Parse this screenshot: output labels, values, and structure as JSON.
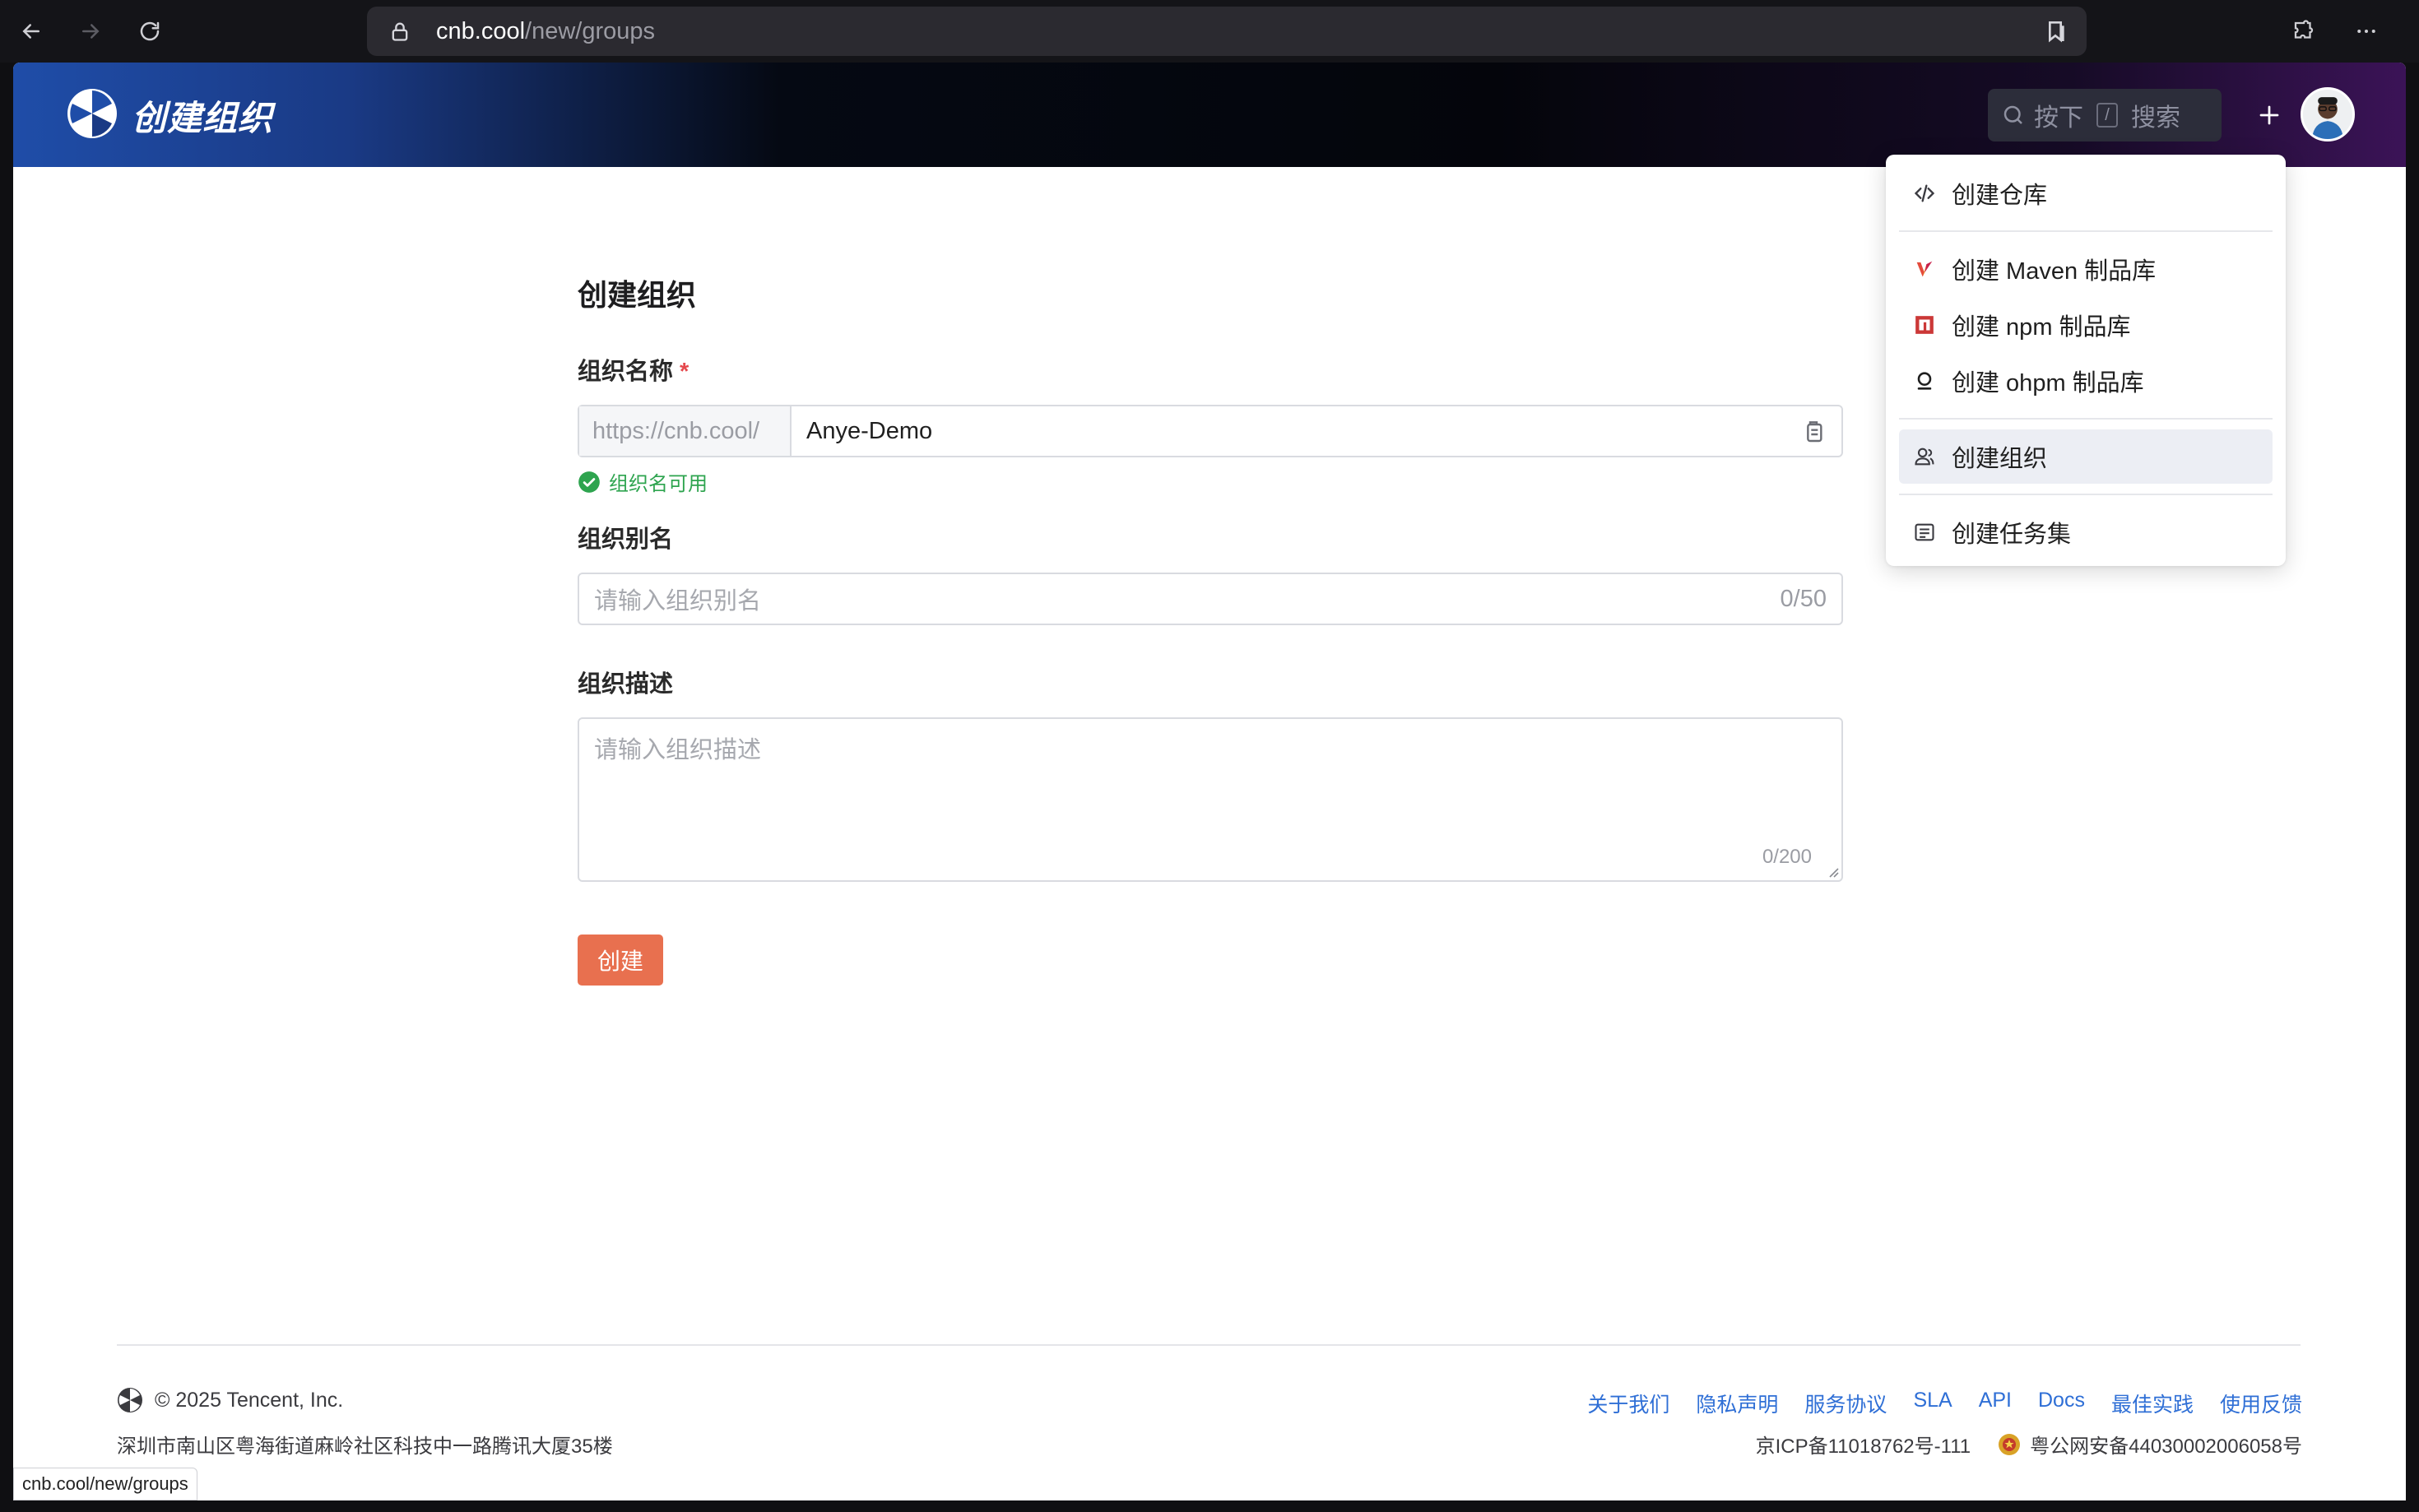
{
  "browser": {
    "url_host": "cnb.cool",
    "url_path": "/new/groups",
    "status_url": "cnb.cool/new/groups"
  },
  "header": {
    "title": "创建组织",
    "search_prefix": "按下",
    "search_key": "/",
    "search_suffix": "搜索"
  },
  "form": {
    "title": "创建组织",
    "name_label": "组织名称",
    "required_mark": "*",
    "name_prefix": "https://cnb.cool/",
    "name_value": "Anye-Demo",
    "name_status": "组织名可用",
    "alias_label": "组织别名",
    "alias_placeholder": "请输入组织别名",
    "alias_count": "0/50",
    "desc_label": "组织描述",
    "desc_placeholder": "请输入组织描述",
    "desc_count": "0/200",
    "submit_label": "创建"
  },
  "menu": {
    "items": [
      {
        "label": "创建仓库",
        "icon": "code-icon"
      },
      {
        "label": "创建 Maven 制品库",
        "icon": "maven-icon"
      },
      {
        "label": "创建 npm 制品库",
        "icon": "npm-icon"
      },
      {
        "label": "创建 ohpm 制品库",
        "icon": "ohpm-icon"
      },
      {
        "label": "创建组织",
        "icon": "users-icon",
        "active": true
      },
      {
        "label": "创建任务集",
        "icon": "list-icon"
      }
    ]
  },
  "footer": {
    "copyright": "© 2025 Tencent, Inc.",
    "address": "深圳市南山区粤海街道麻岭社区科技中一路腾讯大厦35楼",
    "links": [
      "关于我们",
      "隐私声明",
      "服务协议",
      "SLA",
      "API",
      "Docs",
      "最佳实践",
      "使用反馈"
    ],
    "icp": "京ICP备11018762号-111",
    "police": "粤公网安备44030002006058号"
  },
  "colors": {
    "accent": "#e8704f",
    "success": "#2ea44f",
    "link": "#2f6fd6",
    "required": "#e5484d"
  }
}
